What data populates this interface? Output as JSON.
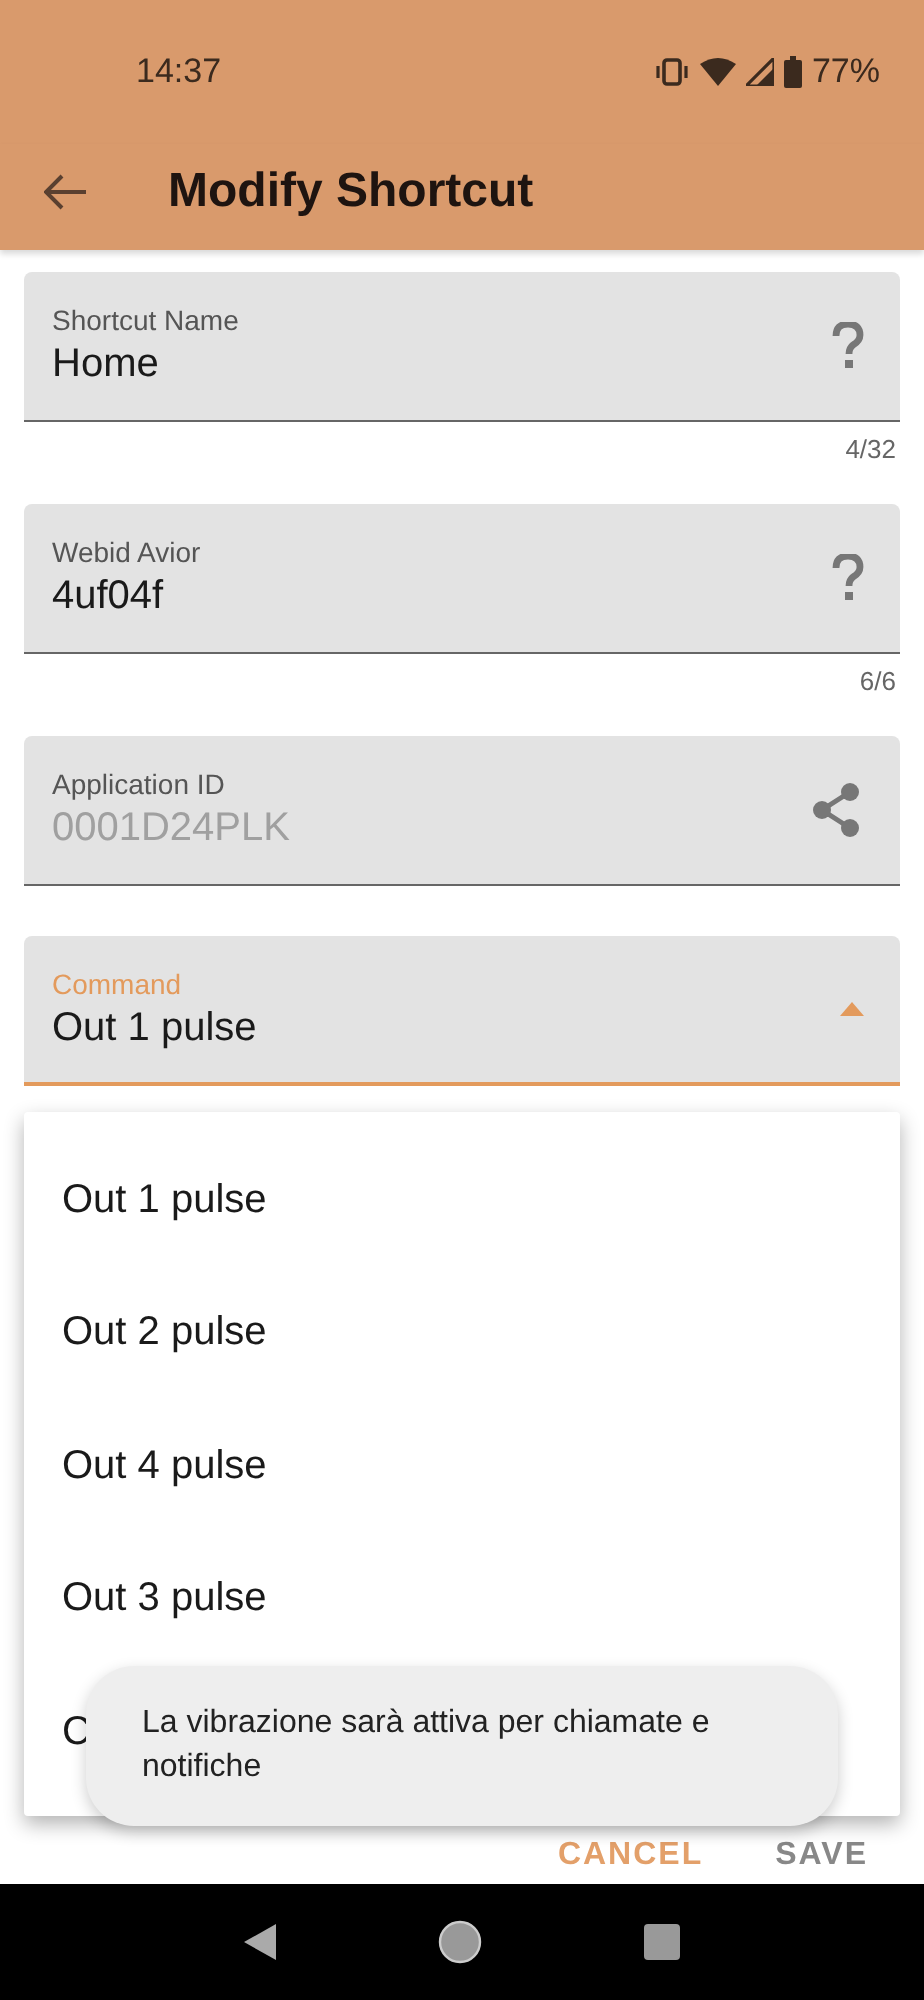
{
  "status_bar": {
    "time": "14:37",
    "battery": "77%"
  },
  "app_bar": {
    "title": "Modify Shortcut"
  },
  "fields": [
    {
      "kind": "help",
      "label": "Shortcut Name",
      "value": "Home",
      "counter": "4/32",
      "disabled": false,
      "focused": false
    },
    {
      "kind": "help",
      "label": "Webid Avior",
      "value": "4uf04f",
      "counter": "6/6",
      "disabled": false,
      "focused": false
    },
    {
      "kind": "share",
      "label": "Application ID",
      "value": "0001D24PLK",
      "disabled": true,
      "focused": false
    },
    {
      "kind": "dropdown",
      "label": "Command",
      "value": "Out 1 pulse",
      "disabled": false,
      "focused": true,
      "expanded": true
    }
  ],
  "menu": {
    "items": [
      {
        "label": "Out 1 pulse"
      },
      {
        "label": "Out 2 pulse"
      },
      {
        "label": "Out 4 pulse"
      },
      {
        "label": "Out 3 pulse"
      },
      {
        "label": "C"
      }
    ]
  },
  "buttons": [
    {
      "label": "CANCEL",
      "kind": "accent"
    },
    {
      "label": "SAVE",
      "kind": "plain"
    }
  ],
  "toast": {
    "text": "La vibrazione sarà attiva per chiamate e notifiche"
  }
}
